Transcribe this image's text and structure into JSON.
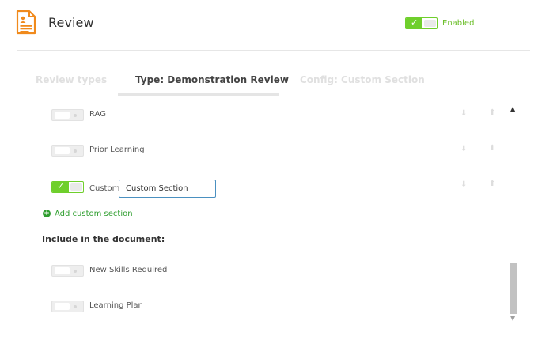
{
  "header": {
    "title": "Review",
    "enabled_label": "Enabled",
    "enabled": true,
    "icon": "document-review-icon",
    "accent_color": "#f08a1c"
  },
  "tabs": [
    {
      "label": "Review types",
      "active": false
    },
    {
      "label": "Type: Demonstration Review",
      "active": true
    },
    {
      "label": "Config: Custom Section",
      "active": false
    }
  ],
  "sections": [
    {
      "label": "RAG",
      "enabled": false
    },
    {
      "label": "Prior Learning",
      "enabled": false
    },
    {
      "label": "Custom:",
      "enabled": true,
      "input_value": "Custom Section"
    }
  ],
  "add_custom_section": "Add custom section",
  "include_heading": "Include in the document:",
  "include_items": [
    {
      "label": "New Skills Required",
      "enabled": false
    },
    {
      "label": "Learning Plan",
      "enabled": false
    }
  ],
  "colors": {
    "toggle_on": "#6fcf2c",
    "link_green": "#2f9e2f",
    "input_border": "#4a90c0"
  }
}
